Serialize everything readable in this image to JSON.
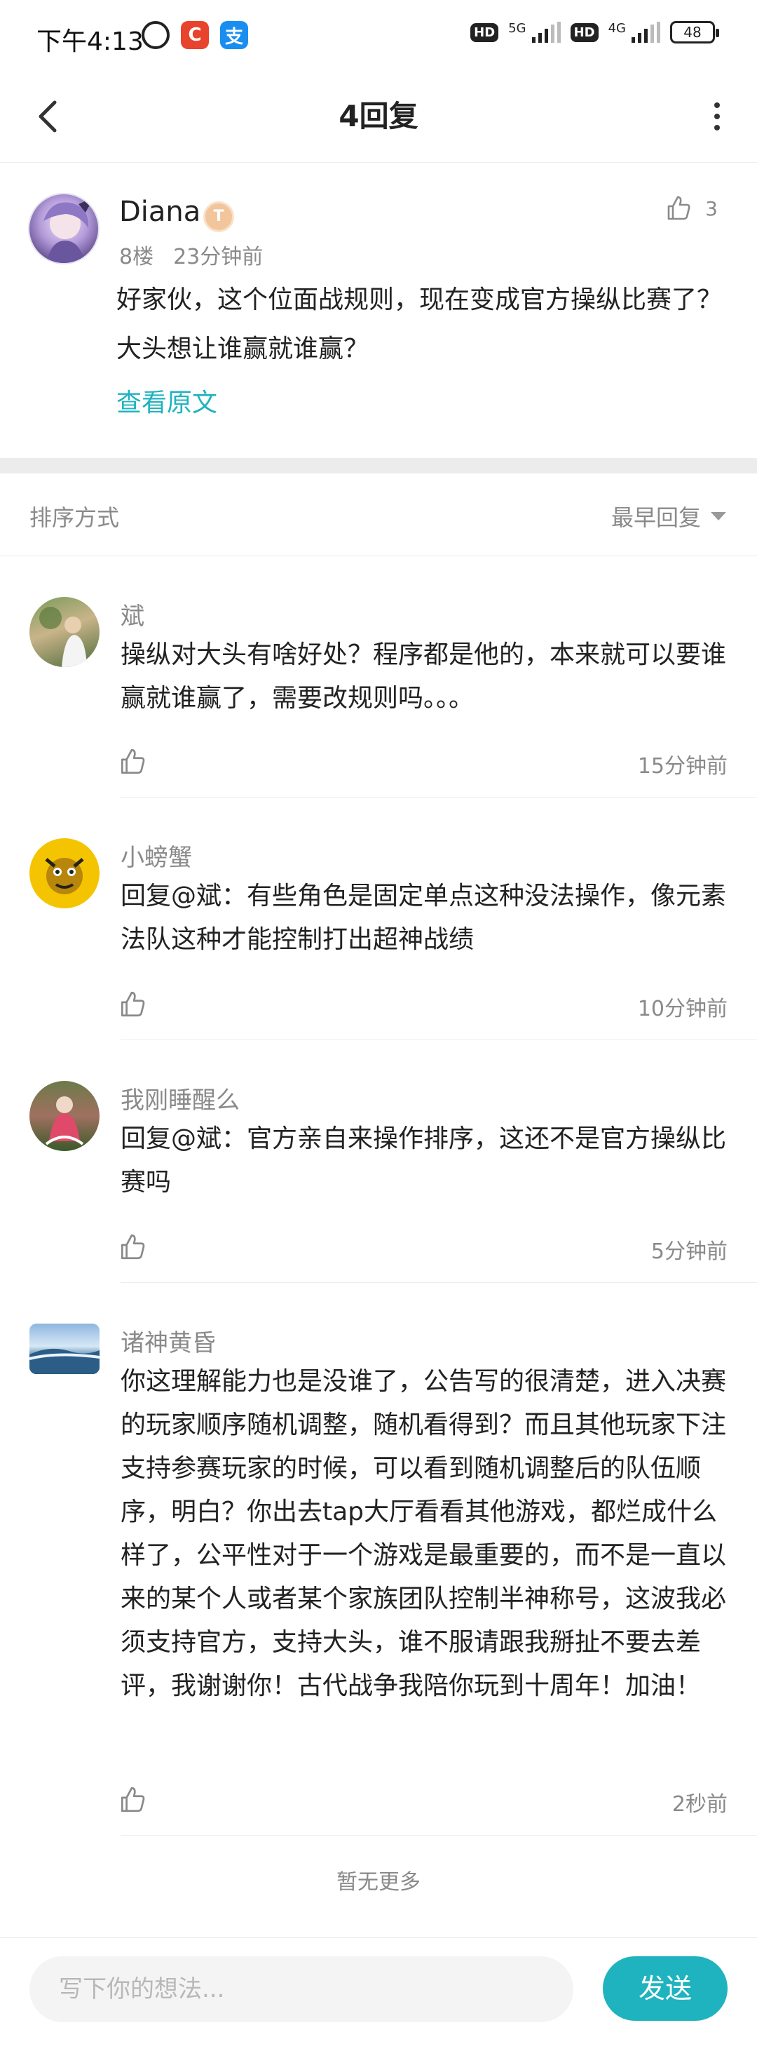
{
  "status_bar": {
    "time": "下午4:13",
    "app_c": "C",
    "app_alipay": "支",
    "hd1": "HD",
    "net1": "5G",
    "hd2": "HD",
    "net2": "4G",
    "battery": "48"
  },
  "header": {
    "title": "4回复"
  },
  "main_post": {
    "author": "Diana",
    "level_badge": "T",
    "floor": "8楼",
    "time": "23分钟前",
    "likes": "3",
    "content": "好家伙，这个位面战规则，现在变成官方操纵比赛了？大头想让谁赢就谁赢？",
    "view_original": "查看原文"
  },
  "sort_bar": {
    "label": "排序方式",
    "selected": "最早回复"
  },
  "comments": [
    {
      "name": "斌",
      "text": "操纵对大头有啥好处？程序都是他的，本来就可以要谁赢就谁赢了，需要改规则吗。。。",
      "time": "15分钟前"
    },
    {
      "name": "小螃蟹",
      "text": "回复@斌：有些角色是固定单点这种没法操作，像元素法队这种才能控制打出超神战绩",
      "time": "10分钟前"
    },
    {
      "name": "我刚睡醒么",
      "text": "回复@斌：官方亲自来操作排序，这还不是官方操纵比赛吗",
      "time": "5分钟前"
    },
    {
      "name": "诸神黄昏",
      "text": "你这理解能力也是没谁了，公告写的很清楚，进入决赛的玩家顺序随机调整，随机看得到？而且其他玩家下注支持参赛玩家的时候，可以看到随机调整后的队伍顺序，明白？你出去tap大厅看看其他游戏，都烂成什么样了，公平性对于一个游戏是最重要的，而不是一直以来的某个人或者某个家族团队控制半神称号，这波我必须支持官方，支持大头，谁不服请跟我掰扯不要去差评，我谢谢你！古代战争我陪你玩到十周年！加油！",
      "time": "2秒前"
    }
  ],
  "footer": {
    "no_more": "暂无更多"
  },
  "input_bar": {
    "placeholder": "写下你的想法...",
    "send_label": "发送"
  },
  "colors": {
    "accent": "#1fb3bf",
    "meta_gray": "#8a8a8a"
  }
}
